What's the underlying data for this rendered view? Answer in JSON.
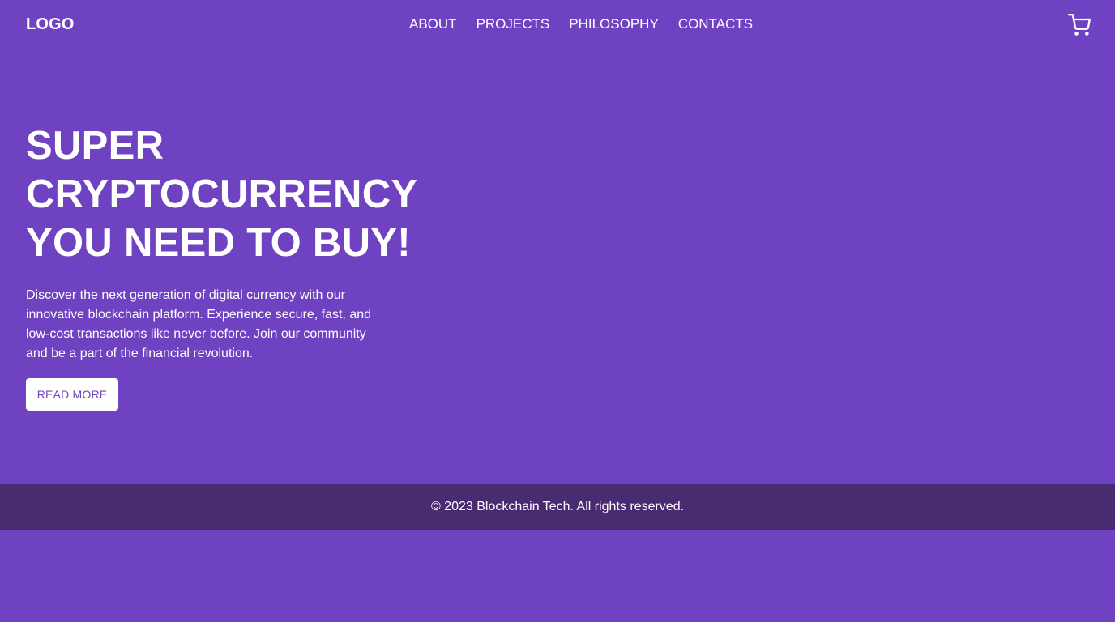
{
  "header": {
    "logo": "LOGO",
    "nav": {
      "about": "ABOUT",
      "projects": "PROJECTS",
      "philosophy": "PHILOSOPHY",
      "contacts": "CONTACTS"
    },
    "cart_icon": "shopping-cart-icon"
  },
  "hero": {
    "title_line1": "SUPER",
    "title_line2": "CRYPTOCURRENCY",
    "title_line3": "YOU NEED TO BUY!",
    "description": "Discover the next generation of digital currency with our innovative blockchain platform. Experience secure, fast, and low-cost transactions like never before. Join our community and be a part of the financial revolution.",
    "cta_label": "READ MORE"
  },
  "footer": {
    "copyright": "© 2023 Blockchain Tech. All rights reserved."
  },
  "colors": {
    "background": "#6f42c1",
    "footer_background": "#482b70",
    "button_background": "#ffffff",
    "button_text": "#6f42c1"
  }
}
